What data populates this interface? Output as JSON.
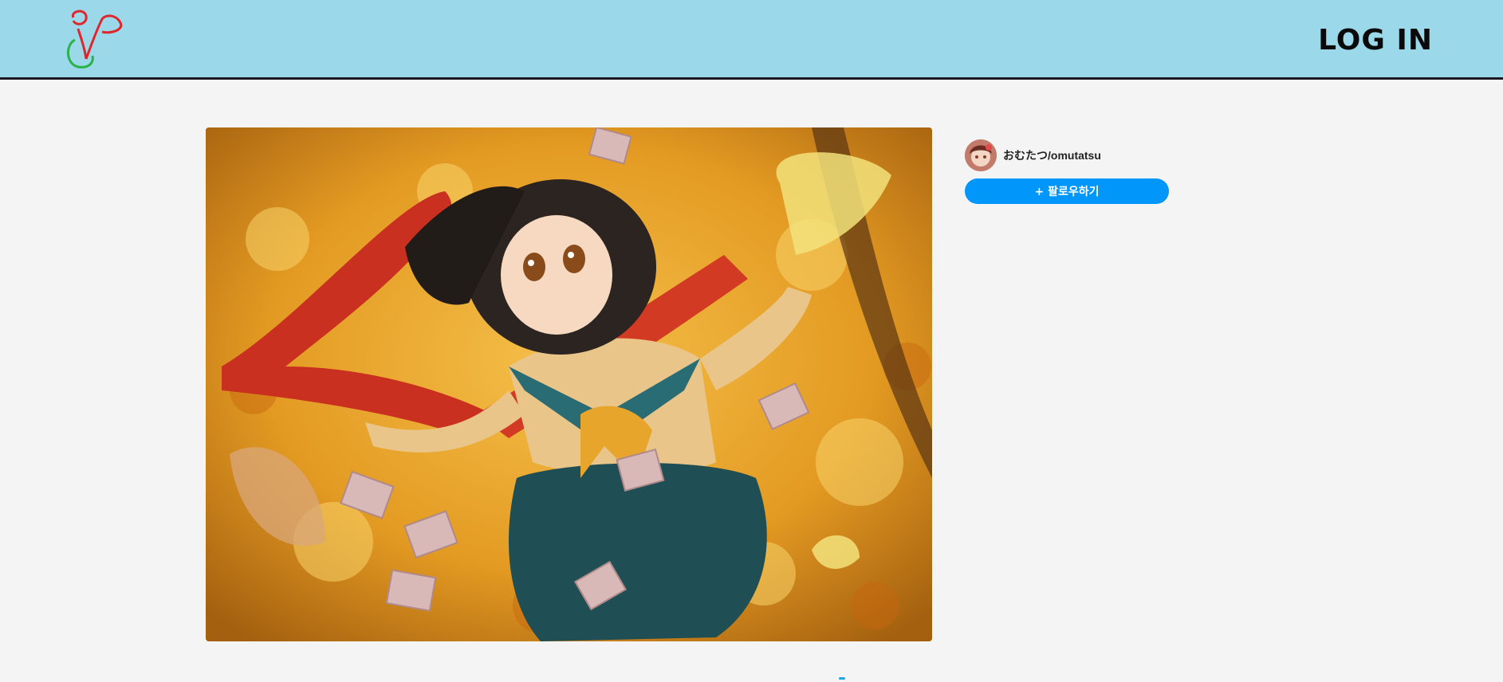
{
  "header": {
    "logo_icon": "pixiv-style-scribble-logo",
    "login_label": "LOG IN",
    "background": "#9bd9ea"
  },
  "artwork": {
    "subject": "artwork-image"
  },
  "author": {
    "name": "おむたつ/omutatsu",
    "avatar_icon": "avatar-image"
  },
  "follow": {
    "label": "+ 팔로우하기",
    "color": "#0096fa"
  }
}
